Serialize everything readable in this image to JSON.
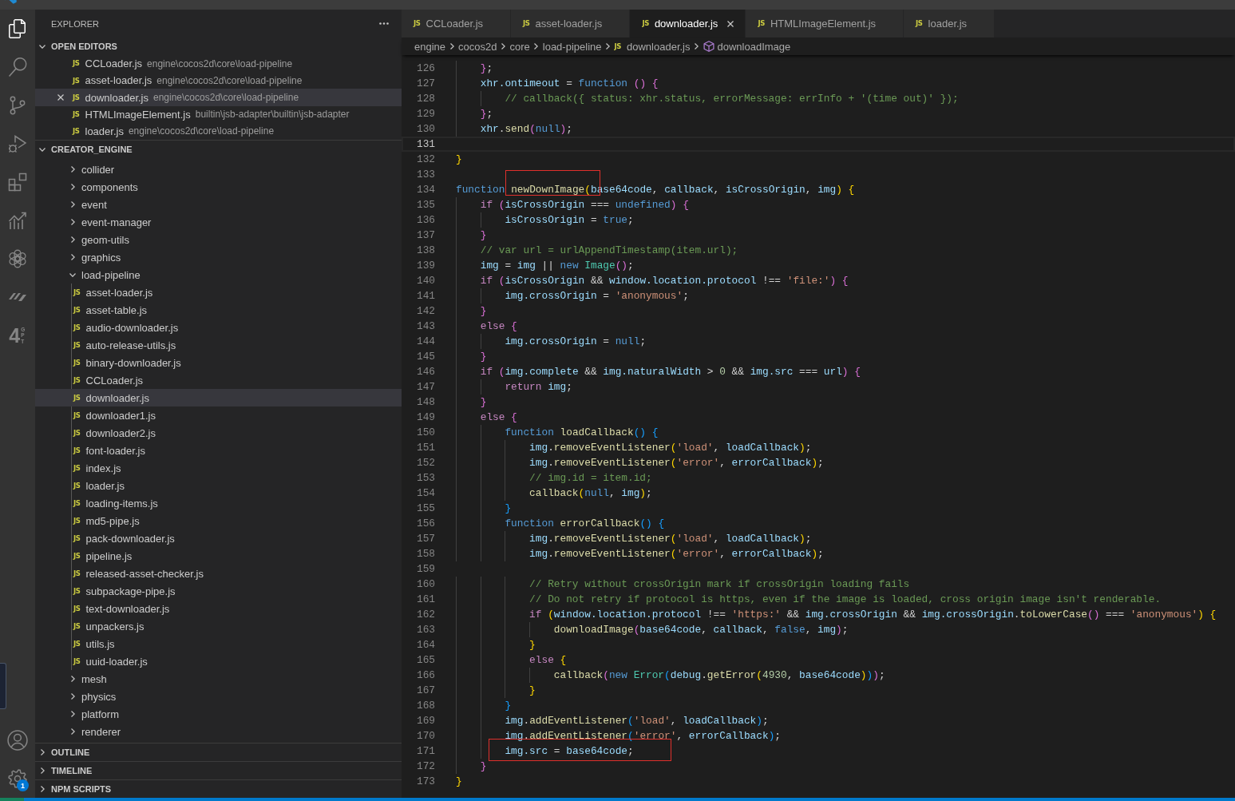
{
  "activity_bar": {
    "top": [
      {
        "kind": "explorer",
        "selected": true
      },
      {
        "kind": "search",
        "selected": false
      },
      {
        "kind": "scm",
        "selected": false
      },
      {
        "kind": "debug",
        "selected": false
      },
      {
        "kind": "extensions",
        "selected": false
      },
      {
        "kind": "chart",
        "selected": false
      },
      {
        "kind": "knot",
        "selected": false
      },
      {
        "kind": "slashes",
        "selected": false
      },
      {
        "kind": "gpt",
        "label": "4",
        "sublabel": "GPT",
        "selected": false
      }
    ],
    "bottom": [
      {
        "kind": "account"
      },
      {
        "kind": "settings",
        "badge": "1"
      }
    ]
  },
  "sidebar": {
    "title": "EXPLORER",
    "sections": [
      {
        "title": "OPEN EDITORS",
        "expanded": true,
        "kind": "editors",
        "items": [
          {
            "name": "CCLoader.js",
            "path": "engine\\cocos2d\\core\\load-pipeline",
            "icon_label": "JS",
            "selected": false
          },
          {
            "name": "asset-loader.js",
            "path": "engine\\cocos2d\\core\\load-pipeline",
            "icon_label": "JS",
            "selected": false
          },
          {
            "name": "downloader.js",
            "path": "engine\\cocos2d\\core\\load-pipeline",
            "icon_label": "JS",
            "selected": true
          },
          {
            "name": "HTMLImageElement.js",
            "path": "builtin\\jsb-adapter\\builtin\\jsb-adapter",
            "icon_label": "JS",
            "selected": false
          },
          {
            "name": "loader.js",
            "path": "engine\\cocos2d\\core\\load-pipeline",
            "icon_label": "JS",
            "selected": false
          }
        ]
      },
      {
        "title": "CREATOR_ENGINE",
        "expanded": true,
        "kind": "tree",
        "items": [
          {
            "name": "collider",
            "kind": "folder",
            "expanded": false,
            "selected": false
          },
          {
            "name": "components",
            "kind": "folder",
            "expanded": false,
            "selected": false
          },
          {
            "name": "event",
            "kind": "folder",
            "expanded": false,
            "selected": false
          },
          {
            "name": "event-manager",
            "kind": "folder",
            "expanded": false,
            "selected": false
          },
          {
            "name": "geom-utils",
            "kind": "folder",
            "expanded": false,
            "selected": false
          },
          {
            "name": "graphics",
            "kind": "folder",
            "expanded": false,
            "selected": false
          },
          {
            "name": "load-pipeline",
            "kind": "folder",
            "expanded": true,
            "selected": false,
            "children": [
              {
                "name": "asset-loader.js",
                "kind": "file",
                "icon_label": "JS",
                "selected": false
              },
              {
                "name": "asset-table.js",
                "kind": "file",
                "icon_label": "JS",
                "selected": false
              },
              {
                "name": "audio-downloader.js",
                "kind": "file",
                "icon_label": "JS",
                "selected": false
              },
              {
                "name": "auto-release-utils.js",
                "kind": "file",
                "icon_label": "JS",
                "selected": false
              },
              {
                "name": "binary-downloader.js",
                "kind": "file",
                "icon_label": "JS",
                "selected": false
              },
              {
                "name": "CCLoader.js",
                "kind": "file",
                "icon_label": "JS",
                "selected": false
              },
              {
                "name": "downloader.js",
                "kind": "file",
                "icon_label": "JS",
                "selected": true
              },
              {
                "name": "downloader1.js",
                "kind": "file",
                "icon_label": "JS",
                "selected": false
              },
              {
                "name": "downloader2.js",
                "kind": "file",
                "icon_label": "JS",
                "selected": false
              },
              {
                "name": "font-loader.js",
                "kind": "file",
                "icon_label": "JS",
                "selected": false
              },
              {
                "name": "index.js",
                "kind": "file",
                "icon_label": "JS",
                "selected": false
              },
              {
                "name": "loader.js",
                "kind": "file",
                "icon_label": "JS",
                "selected": false
              },
              {
                "name": "loading-items.js",
                "kind": "file",
                "icon_label": "JS",
                "selected": false
              },
              {
                "name": "md5-pipe.js",
                "kind": "file",
                "icon_label": "JS",
                "selected": false
              },
              {
                "name": "pack-downloader.js",
                "kind": "file",
                "icon_label": "JS",
                "selected": false
              },
              {
                "name": "pipeline.js",
                "kind": "file",
                "icon_label": "JS",
                "selected": false
              },
              {
                "name": "released-asset-checker.js",
                "kind": "file",
                "icon_label": "JS",
                "selected": false
              },
              {
                "name": "subpackage-pipe.js",
                "kind": "file",
                "icon_label": "JS",
                "selected": false
              },
              {
                "name": "text-downloader.js",
                "kind": "file",
                "icon_label": "JS",
                "selected": false
              },
              {
                "name": "unpackers.js",
                "kind": "file",
                "icon_label": "JS",
                "selected": false
              },
              {
                "name": "utils.js",
                "kind": "file",
                "icon_label": "JS",
                "selected": false
              },
              {
                "name": "uuid-loader.js",
                "kind": "file",
                "icon_label": "JS",
                "selected": false
              }
            ]
          },
          {
            "name": "mesh",
            "kind": "folder",
            "expanded": false,
            "selected": false
          },
          {
            "name": "physics",
            "kind": "folder",
            "expanded": false,
            "selected": false
          },
          {
            "name": "platform",
            "kind": "folder",
            "expanded": false,
            "selected": false
          },
          {
            "name": "renderer",
            "kind": "folder",
            "expanded": false,
            "selected": false
          }
        ]
      },
      {
        "title": "OUTLINE",
        "expanded": false
      },
      {
        "title": "TIMELINE",
        "expanded": false
      },
      {
        "title": "NPM SCRIPTS",
        "expanded": false
      }
    ]
  },
  "editor": {
    "tabs": [
      {
        "label": "CCLoader.js",
        "icon_label": "JS",
        "selected": false
      },
      {
        "label": "asset-loader.js",
        "icon_label": "JS",
        "selected": false
      },
      {
        "label": "downloader.js",
        "icon_label": "JS",
        "selected": true
      },
      {
        "label": "HTMLImageElement.js",
        "icon_label": "JS",
        "selected": false
      },
      {
        "label": "loader.js",
        "icon_label": "JS",
        "selected": false
      }
    ],
    "breadcrumb": [
      {
        "label": "engine",
        "kind": "folder"
      },
      {
        "label": "cocos2d",
        "kind": "folder"
      },
      {
        "label": "core",
        "kind": "folder"
      },
      {
        "label": "load-pipeline",
        "kind": "folder"
      },
      {
        "label": "downloader.js",
        "kind": "file",
        "icon_label": "JS"
      },
      {
        "label": "downloadImage",
        "kind": "method"
      }
    ],
    "lines": [
      {
        "number": "126",
        "current": false,
        "spans": [
          {
            "kind": "b2",
            "text": "    }"
          },
          {
            "kind": "pl",
            "text": ";"
          }
        ]
      },
      {
        "number": "127",
        "current": false,
        "spans": [
          {
            "kind": "var",
            "text": "    xhr.ontimeout"
          },
          {
            "kind": "pl",
            "text": " = "
          },
          {
            "kind": "kw",
            "text": "function "
          },
          {
            "kind": "b2",
            "text": "() {"
          }
        ]
      },
      {
        "number": "128",
        "current": false,
        "spans": [
          {
            "kind": "com",
            "text": "        // callback({ status: xhr.status, errorMessage: errInfo + '(time out)' });"
          }
        ]
      },
      {
        "number": "129",
        "current": false,
        "spans": [
          {
            "kind": "b2",
            "text": "    }"
          },
          {
            "kind": "pl",
            "text": ";"
          }
        ]
      },
      {
        "number": "130",
        "current": false,
        "spans": [
          {
            "kind": "var",
            "text": "    xhr"
          },
          {
            "kind": "pl",
            "text": "."
          },
          {
            "kind": "fn",
            "text": "send"
          },
          {
            "kind": "b2",
            "text": "("
          },
          {
            "kind": "kw",
            "text": "null"
          },
          {
            "kind": "b2",
            "text": ")"
          },
          {
            "kind": "pl",
            "text": ";"
          }
        ]
      },
      {
        "number": "131",
        "current": true
      },
      {
        "number": "132",
        "current": false,
        "spans": [
          {
            "kind": "b1",
            "text": "}"
          }
        ]
      },
      {
        "number": "133",
        "current": false
      },
      {
        "number": "134",
        "current": false,
        "spans": [
          {
            "kind": "kw",
            "text": "function "
          },
          {
            "kind": "frame",
            "spans": [
              {
                "kind": "fn",
                "text": "newDownImage"
              }
            ]
          },
          {
            "kind": "b1",
            "text": "("
          },
          {
            "kind": "var",
            "text": "base64code"
          },
          {
            "kind": "pl",
            "text": ", "
          },
          {
            "kind": "var",
            "text": "callback"
          },
          {
            "kind": "pl",
            "text": ", "
          },
          {
            "kind": "var",
            "text": "isCrossOrigin"
          },
          {
            "kind": "pl",
            "text": ", "
          },
          {
            "kind": "var",
            "text": "img"
          },
          {
            "kind": "b1",
            "text": ") {"
          }
        ]
      },
      {
        "number": "135",
        "current": false,
        "spans": [
          {
            "kind": "ctl",
            "text": "    if "
          },
          {
            "kind": "b2",
            "text": "("
          },
          {
            "kind": "var",
            "text": "isCrossOrigin"
          },
          {
            "kind": "pl",
            "text": " === "
          },
          {
            "kind": "kw",
            "text": "undefined"
          },
          {
            "kind": "b2",
            "text": ") {"
          }
        ]
      },
      {
        "number": "136",
        "current": false,
        "spans": [
          {
            "kind": "var",
            "text": "        isCrossOrigin"
          },
          {
            "kind": "pl",
            "text": " = "
          },
          {
            "kind": "kw",
            "text": "true"
          },
          {
            "kind": "pl",
            "text": ";"
          }
        ]
      },
      {
        "number": "137",
        "current": false,
        "spans": [
          {
            "kind": "b2",
            "text": "    }"
          }
        ]
      },
      {
        "number": "138",
        "current": false,
        "spans": [
          {
            "kind": "com",
            "text": "    // var url = urlAppendTimestamp(item.url);"
          }
        ]
      },
      {
        "number": "139",
        "current": false,
        "spans": [
          {
            "kind": "var",
            "text": "    img"
          },
          {
            "kind": "pl",
            "text": " = "
          },
          {
            "kind": "var",
            "text": "img"
          },
          {
            "kind": "pl",
            "text": " || "
          },
          {
            "kind": "kw",
            "text": "new "
          },
          {
            "kind": "cls",
            "text": "Image"
          },
          {
            "kind": "b2",
            "text": "()"
          },
          {
            "kind": "pl",
            "text": ";"
          }
        ]
      },
      {
        "number": "140",
        "current": false,
        "spans": [
          {
            "kind": "ctl",
            "text": "    if "
          },
          {
            "kind": "b2",
            "text": "("
          },
          {
            "kind": "var",
            "text": "isCrossOrigin"
          },
          {
            "kind": "pl",
            "text": " && "
          },
          {
            "kind": "var",
            "text": "window.location.protocol"
          },
          {
            "kind": "pl",
            "text": " !== "
          },
          {
            "kind": "str",
            "text": "'file:'"
          },
          {
            "kind": "b2",
            "text": ") {"
          }
        ]
      },
      {
        "number": "141",
        "current": false,
        "spans": [
          {
            "kind": "var",
            "text": "        img.crossOrigin"
          },
          {
            "kind": "pl",
            "text": " = "
          },
          {
            "kind": "str",
            "text": "'anonymous'"
          },
          {
            "kind": "pl",
            "text": ";"
          }
        ]
      },
      {
        "number": "142",
        "current": false,
        "spans": [
          {
            "kind": "b2",
            "text": "    }"
          }
        ]
      },
      {
        "number": "143",
        "current": false,
        "spans": [
          {
            "kind": "ctl",
            "text": "    else "
          },
          {
            "kind": "b2",
            "text": "{"
          }
        ]
      },
      {
        "number": "144",
        "current": false,
        "spans": [
          {
            "kind": "var",
            "text": "        img.crossOrigin"
          },
          {
            "kind": "pl",
            "text": " = "
          },
          {
            "kind": "kw",
            "text": "null"
          },
          {
            "kind": "pl",
            "text": ";"
          }
        ]
      },
      {
        "number": "145",
        "current": false,
        "spans": [
          {
            "kind": "b2",
            "text": "    }"
          }
        ]
      },
      {
        "number": "146",
        "current": false,
        "spans": [
          {
            "kind": "ctl",
            "text": "    if "
          },
          {
            "kind": "b2",
            "text": "("
          },
          {
            "kind": "var",
            "text": "img.complete"
          },
          {
            "kind": "pl",
            "text": " && "
          },
          {
            "kind": "var",
            "text": "img.naturalWidth"
          },
          {
            "kind": "pl",
            "text": " > "
          },
          {
            "kind": "num",
            "text": "0"
          },
          {
            "kind": "pl",
            "text": " && "
          },
          {
            "kind": "var",
            "text": "img.src"
          },
          {
            "kind": "pl",
            "text": " === "
          },
          {
            "kind": "var",
            "text": "url"
          },
          {
            "kind": "b2",
            "text": ") {"
          }
        ]
      },
      {
        "number": "147",
        "current": false,
        "spans": [
          {
            "kind": "ctl",
            "text": "        return "
          },
          {
            "kind": "var",
            "text": "img"
          },
          {
            "kind": "pl",
            "text": ";"
          }
        ]
      },
      {
        "number": "148",
        "current": false,
        "spans": [
          {
            "kind": "b2",
            "text": "    }"
          }
        ]
      },
      {
        "number": "149",
        "current": false,
        "spans": [
          {
            "kind": "ctl",
            "text": "    else "
          },
          {
            "kind": "b2",
            "text": "{"
          }
        ]
      },
      {
        "number": "150",
        "current": false,
        "spans": [
          {
            "kind": "kw",
            "text": "        function "
          },
          {
            "kind": "fn",
            "text": "loadCallback"
          },
          {
            "kind": "b3",
            "text": "() {"
          }
        ]
      },
      {
        "number": "151",
        "current": false,
        "spans": [
          {
            "kind": "var",
            "text": "            img"
          },
          {
            "kind": "pl",
            "text": "."
          },
          {
            "kind": "fn",
            "text": "removeEventListener"
          },
          {
            "kind": "b1",
            "text": "("
          },
          {
            "kind": "str",
            "text": "'load'"
          },
          {
            "kind": "pl",
            "text": ", "
          },
          {
            "kind": "var",
            "text": "loadCallback"
          },
          {
            "kind": "b1",
            "text": ")"
          },
          {
            "kind": "pl",
            "text": ";"
          }
        ]
      },
      {
        "number": "152",
        "current": false,
        "spans": [
          {
            "kind": "var",
            "text": "            img"
          },
          {
            "kind": "pl",
            "text": "."
          },
          {
            "kind": "fn",
            "text": "removeEventListener"
          },
          {
            "kind": "b1",
            "text": "("
          },
          {
            "kind": "str",
            "text": "'error'"
          },
          {
            "kind": "pl",
            "text": ", "
          },
          {
            "kind": "var",
            "text": "errorCallback"
          },
          {
            "kind": "b1",
            "text": ")"
          },
          {
            "kind": "pl",
            "text": ";"
          }
        ]
      },
      {
        "number": "153",
        "current": false,
        "spans": [
          {
            "kind": "com",
            "text": "            // img.id = item.id;"
          }
        ]
      },
      {
        "number": "154",
        "current": false,
        "spans": [
          {
            "kind": "fn",
            "text": "            callback"
          },
          {
            "kind": "b1",
            "text": "("
          },
          {
            "kind": "kw",
            "text": "null"
          },
          {
            "kind": "pl",
            "text": ", "
          },
          {
            "kind": "var",
            "text": "img"
          },
          {
            "kind": "b1",
            "text": ")"
          },
          {
            "kind": "pl",
            "text": ";"
          }
        ]
      },
      {
        "number": "155",
        "current": false,
        "spans": [
          {
            "kind": "b3",
            "text": "        }"
          }
        ]
      },
      {
        "number": "156",
        "current": false,
        "spans": [
          {
            "kind": "kw",
            "text": "        function "
          },
          {
            "kind": "fn",
            "text": "errorCallback"
          },
          {
            "kind": "b3",
            "text": "() {"
          }
        ]
      },
      {
        "number": "157",
        "current": false,
        "spans": [
          {
            "kind": "var",
            "text": "            img"
          },
          {
            "kind": "pl",
            "text": "."
          },
          {
            "kind": "fn",
            "text": "removeEventListener"
          },
          {
            "kind": "b1",
            "text": "("
          },
          {
            "kind": "str",
            "text": "'load'"
          },
          {
            "kind": "pl",
            "text": ", "
          },
          {
            "kind": "var",
            "text": "loadCallback"
          },
          {
            "kind": "b1",
            "text": ")"
          },
          {
            "kind": "pl",
            "text": ";"
          }
        ]
      },
      {
        "number": "158",
        "current": false,
        "spans": [
          {
            "kind": "var",
            "text": "            img"
          },
          {
            "kind": "pl",
            "text": "."
          },
          {
            "kind": "fn",
            "text": "removeEventListener"
          },
          {
            "kind": "b1",
            "text": "("
          },
          {
            "kind": "str",
            "text": "'error'"
          },
          {
            "kind": "pl",
            "text": ", "
          },
          {
            "kind": "var",
            "text": "errorCallback"
          },
          {
            "kind": "b1",
            "text": ")"
          },
          {
            "kind": "pl",
            "text": ";"
          }
        ]
      },
      {
        "number": "159",
        "current": false
      },
      {
        "number": "160",
        "current": false,
        "spans": [
          {
            "kind": "com",
            "text": "            // Retry without crossOrigin mark if crossOrigin loading fails"
          }
        ]
      },
      {
        "number": "161",
        "current": false,
        "spans": [
          {
            "kind": "com",
            "text": "            // Do not retry if protocol is https, even if the image is loaded, cross origin image isn't renderable."
          }
        ]
      },
      {
        "number": "162",
        "current": false,
        "spans": [
          {
            "kind": "ctl",
            "text": "            if "
          },
          {
            "kind": "b1",
            "text": "("
          },
          {
            "kind": "var",
            "text": "window.location.protocol"
          },
          {
            "kind": "pl",
            "text": " !== "
          },
          {
            "kind": "str",
            "text": "'https:'"
          },
          {
            "kind": "pl",
            "text": " && "
          },
          {
            "kind": "var",
            "text": "img.crossOrigin"
          },
          {
            "kind": "pl",
            "text": " && "
          },
          {
            "kind": "var",
            "text": "img.crossOrigin"
          },
          {
            "kind": "pl",
            "text": "."
          },
          {
            "kind": "fn",
            "text": "toLowerCase"
          },
          {
            "kind": "b2",
            "text": "()"
          },
          {
            "kind": "pl",
            "text": " === "
          },
          {
            "kind": "str",
            "text": "'anonymous'"
          },
          {
            "kind": "b1",
            "text": ") {"
          }
        ]
      },
      {
        "number": "163",
        "current": false,
        "spans": [
          {
            "kind": "fn",
            "text": "                downloadImage"
          },
          {
            "kind": "b2",
            "text": "("
          },
          {
            "kind": "var",
            "text": "base64code"
          },
          {
            "kind": "pl",
            "text": ", "
          },
          {
            "kind": "var",
            "text": "callback"
          },
          {
            "kind": "pl",
            "text": ", "
          },
          {
            "kind": "kw",
            "text": "false"
          },
          {
            "kind": "pl",
            "text": ", "
          },
          {
            "kind": "var",
            "text": "img"
          },
          {
            "kind": "b2",
            "text": ")"
          },
          {
            "kind": "pl",
            "text": ";"
          }
        ]
      },
      {
        "number": "164",
        "current": false,
        "spans": [
          {
            "kind": "b1",
            "text": "            }"
          }
        ]
      },
      {
        "number": "165",
        "current": false,
        "spans": [
          {
            "kind": "ctl",
            "text": "            else "
          },
          {
            "kind": "b1",
            "text": "{"
          }
        ]
      },
      {
        "number": "166",
        "current": false,
        "spans": [
          {
            "kind": "fn",
            "text": "                callback"
          },
          {
            "kind": "b2",
            "text": "("
          },
          {
            "kind": "kw",
            "text": "new "
          },
          {
            "kind": "cls",
            "text": "Error"
          },
          {
            "kind": "b3",
            "text": "("
          },
          {
            "kind": "var",
            "text": "debug"
          },
          {
            "kind": "pl",
            "text": "."
          },
          {
            "kind": "fn",
            "text": "getError"
          },
          {
            "kind": "b1",
            "text": "("
          },
          {
            "kind": "num",
            "text": "4930"
          },
          {
            "kind": "pl",
            "text": ", "
          },
          {
            "kind": "var",
            "text": "base64code"
          },
          {
            "kind": "b1",
            "text": ")"
          },
          {
            "kind": "b3",
            "text": ")"
          },
          {
            "kind": "b2",
            "text": ")"
          },
          {
            "kind": "pl",
            "text": ";"
          }
        ]
      },
      {
        "number": "167",
        "current": false,
        "spans": [
          {
            "kind": "b1",
            "text": "            }"
          }
        ]
      },
      {
        "number": "168",
        "current": false,
        "spans": [
          {
            "kind": "b3",
            "text": "        }"
          }
        ]
      },
      {
        "number": "169",
        "current": false,
        "spans": [
          {
            "kind": "var",
            "text": "        img"
          },
          {
            "kind": "pl",
            "text": "."
          },
          {
            "kind": "fn",
            "text": "addEventListener"
          },
          {
            "kind": "b3",
            "text": "("
          },
          {
            "kind": "str",
            "text": "'load'"
          },
          {
            "kind": "pl",
            "text": ", "
          },
          {
            "kind": "var",
            "text": "loadCallback"
          },
          {
            "kind": "b3",
            "text": ")"
          },
          {
            "kind": "pl",
            "text": ";"
          }
        ]
      },
      {
        "number": "170",
        "current": false,
        "spans": [
          {
            "kind": "var",
            "text": "        img"
          },
          {
            "kind": "pl",
            "text": "."
          },
          {
            "kind": "fn",
            "text": "addEventListener"
          },
          {
            "kind": "b3",
            "text": "("
          },
          {
            "kind": "str",
            "text": "'error'"
          },
          {
            "kind": "pl",
            "text": ", "
          },
          {
            "kind": "var",
            "text": "errorCallback"
          },
          {
            "kind": "b3",
            "text": ")"
          },
          {
            "kind": "pl",
            "text": ";"
          }
        ]
      },
      {
        "number": "171",
        "current": false,
        "spans": [
          {
            "kind": "frame",
            "spans": [
              {
                "kind": "var",
                "text": "        img.src"
              },
              {
                "kind": "pl",
                "text": " = "
              },
              {
                "kind": "var",
                "text": "base64code"
              },
              {
                "kind": "pl",
                "text": ";"
              }
            ]
          }
        ]
      },
      {
        "number": "172",
        "current": false,
        "spans": [
          {
            "kind": "b2",
            "text": "    }"
          }
        ]
      },
      {
        "number": "173",
        "current": false,
        "spans": [
          {
            "kind": "b1",
            "text": "}"
          }
        ]
      }
    ]
  }
}
